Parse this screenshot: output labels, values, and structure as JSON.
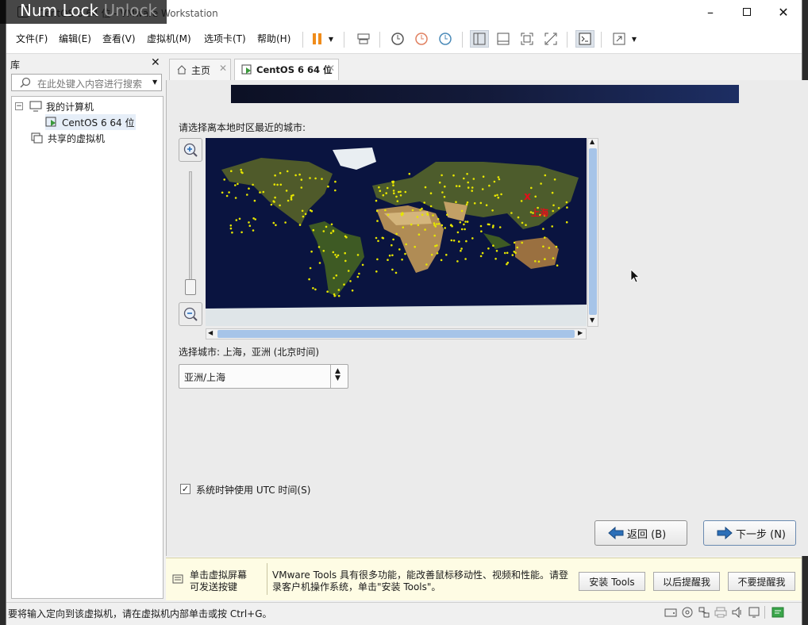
{
  "overlay": {
    "numlock_text": "Num Lock",
    "numlock_state": "Unlock"
  },
  "window": {
    "title": "CentOS 6 64 位 - VMware Workstation"
  },
  "menu": [
    "文件(F)",
    "编辑(E)",
    "查看(V)",
    "虚拟机(M)",
    "选项卡(T)",
    "帮助(H)"
  ],
  "library": {
    "title": "库",
    "search_placeholder": "在此处键入内容进行搜索",
    "tree": {
      "my_computer": "我的计算机",
      "vm": "CentOS 6 64 位",
      "shared": "共享的虚拟机"
    }
  },
  "tabs": {
    "home": "主页",
    "vm": "CentOS 6 64 位"
  },
  "installer": {
    "prompt": "请选择离本地时区最近的城市:",
    "selected_city_label": "选择城市: 上海，亚洲 (北京时间)",
    "map_marker_label": "上海",
    "timezone_value": "亚洲/上海",
    "utc_label": "系统时钟使用 UTC 时间(S)",
    "utc_checked": true,
    "back_label": "返回 (B)",
    "next_label": "下一步 (N)"
  },
  "tools_bar": {
    "hint_line1": "单击虚拟屏幕",
    "hint_line2": "可发送按键",
    "message_line1": "VMware Tools 具有很多功能，能改善鼠标移动性、视频和性能。请登",
    "message_line2": "录客户机操作系统，单击\"安装 Tools\"。",
    "install_label": "安装 Tools",
    "later_label": "以后提醒我",
    "never_label": "不要提醒我"
  },
  "status_bar": {
    "text": "要将输入定向到该虚拟机，请在虚拟机内部单击或按 Ctrl+G。"
  },
  "colors": {
    "accent_blue": "#2c6fb8",
    "map_ocean": "#0a1440",
    "city_dot": "#e6e600",
    "marker_red": "#e0101a",
    "tools_bg": "#fefce4"
  }
}
